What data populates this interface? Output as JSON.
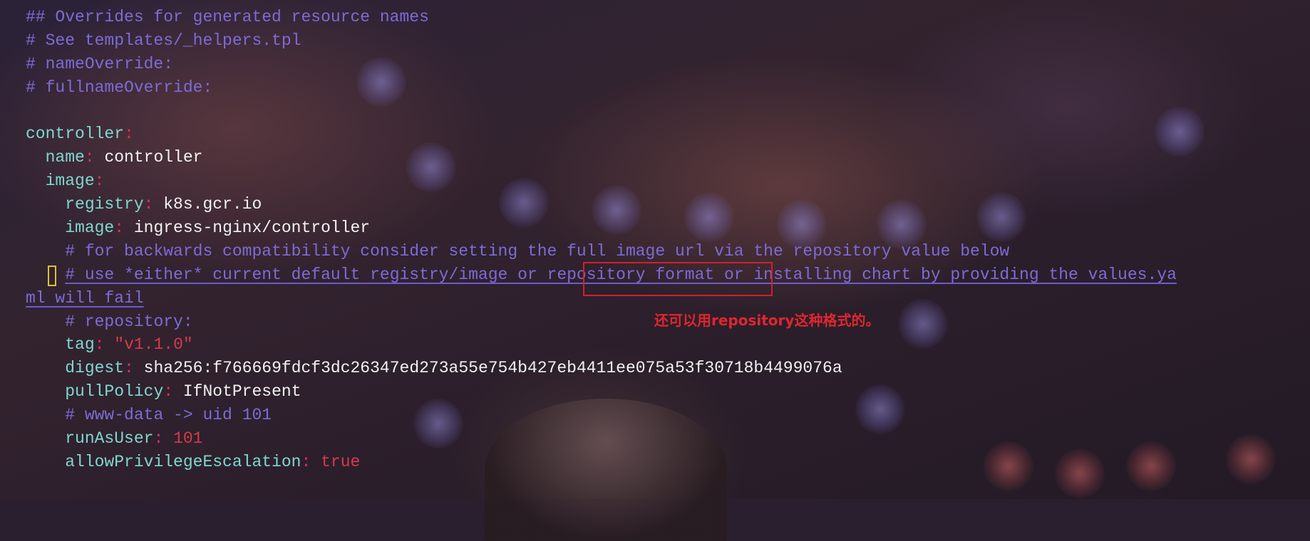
{
  "editor": {
    "lines": [
      {
        "comment": "## Overrides for generated resource names"
      },
      {
        "comment": "# See templates/_helpers.tpl"
      },
      {
        "comment": "# nameOverride:"
      },
      {
        "comment": "# fullnameOverride:"
      },
      {},
      {
        "key": "controller",
        "colon": ":"
      },
      {
        "indent": "  ",
        "key": "name",
        "colon": ":",
        "value": " controller"
      },
      {
        "indent": "  ",
        "key": "image",
        "colon": ":"
      },
      {
        "indent": "    ",
        "key": "registry",
        "colon": ":",
        "value": " k8s.gcr.io"
      },
      {
        "indent": "    ",
        "key": "image",
        "colon": ":",
        "value": " ingress-nginx/controller"
      },
      {
        "indent": "    ",
        "comment": "# for backwards compatibility consider setting the full image url via the repository value below"
      },
      {
        "indent": "    ",
        "comment": "# use *either* current default registry/image or repository format or installing chart by providing the values.ya"
      },
      {
        "comment": "ml will fail"
      },
      {
        "indent": "    ",
        "comment": "# repository:"
      },
      {
        "indent": "    ",
        "key": "tag",
        "colon": ":",
        "value": " ",
        "string": "\"v1.1.0\""
      },
      {
        "indent": "    ",
        "key": "digest",
        "colon": ":",
        "value": " sha256:f766669fdcf3dc26347ed273a55e754b427eb4411ee075a53f30718b4499076a"
      },
      {
        "indent": "    ",
        "key": "pullPolicy",
        "colon": ":",
        "value": " IfNotPresent"
      },
      {
        "indent": "    ",
        "comment": "# www-data -> uid 101"
      },
      {
        "indent": "    ",
        "key": "runAsUser",
        "colon": ":",
        "value": " ",
        "number": "101"
      },
      {
        "indent": "    ",
        "key": "allowPrivilegeEscalation",
        "colon": ":",
        "value": " ",
        "bool": "true"
      }
    ]
  },
  "annotation": {
    "note": "还可以用repository这种格式的。"
  },
  "colors": {
    "comment": "#7d6bd6",
    "key": "#7fd7cf",
    "colon": "#e2305a",
    "value": "#f2f2f2",
    "literal": "#d83a4a",
    "annotation": "#e0262f",
    "cursor": "#e0c030"
  }
}
